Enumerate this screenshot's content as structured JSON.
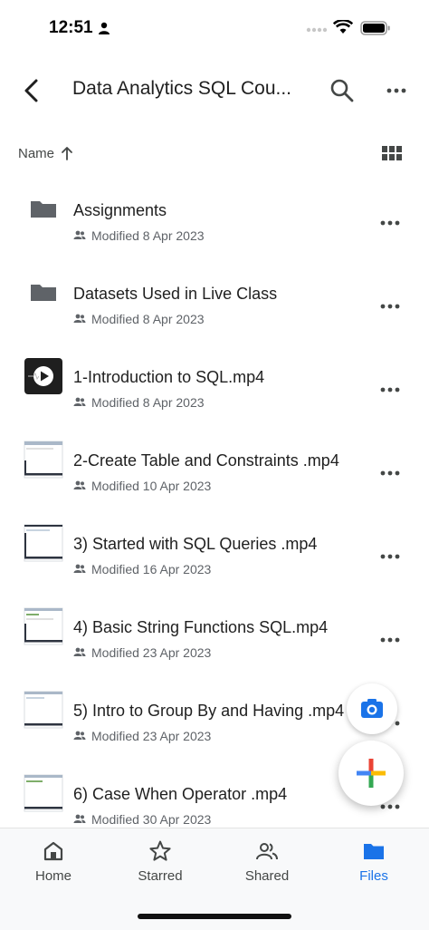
{
  "status_bar": {
    "time": "12:51"
  },
  "app_bar": {
    "title": "Data Analytics SQL Cou..."
  },
  "sort": {
    "label": "Name"
  },
  "files": [
    {
      "name": "Assignments",
      "meta": "Modified 8 Apr 2023",
      "kind": "folder"
    },
    {
      "name": "Datasets Used in Live Class",
      "meta": "Modified 8 Apr 2023",
      "kind": "folder"
    },
    {
      "name": "1-Introduction to SQL.mp4",
      "meta": "Modified 8 Apr 2023",
      "kind": "video-dark"
    },
    {
      "name": "2-Create Table and Constraints .mp4",
      "meta": "Modified 10 Apr 2023",
      "kind": "video-screenshot"
    },
    {
      "name": "3) Started with SQL Queries .mp4",
      "meta": "Modified 16 Apr 2023",
      "kind": "video-screenshot"
    },
    {
      "name": "4) Basic String Functions SQL.mp4",
      "meta": "Modified 23 Apr 2023",
      "kind": "video-screenshot"
    },
    {
      "name": "5) Intro to Group By and Having .mp4",
      "meta": "Modified 23 Apr 2023",
      "kind": "video-screenshot"
    },
    {
      "name": "6) Case When Operator .mp4",
      "meta": "Modified 30 Apr 2023",
      "kind": "video-screenshot"
    }
  ],
  "bottom_nav": {
    "items": [
      {
        "label": "Home",
        "icon": "home-icon"
      },
      {
        "label": "Starred",
        "icon": "star-icon"
      },
      {
        "label": "Shared",
        "icon": "shared-people-icon"
      },
      {
        "label": "Files",
        "icon": "folder-icon"
      }
    ],
    "active": "Files"
  },
  "colors": {
    "accent": "#1a73e8",
    "folder": "#5f6368"
  }
}
